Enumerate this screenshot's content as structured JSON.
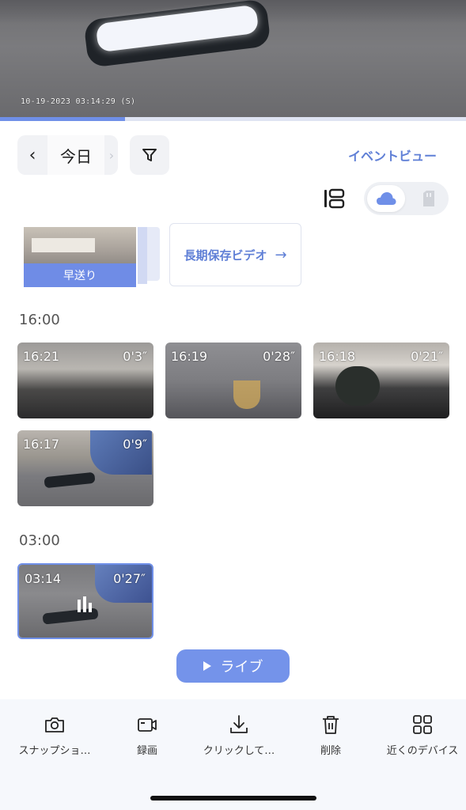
{
  "player": {
    "osd_timestamp": "10-19-2023 03:14:29  (S)",
    "progress": 0.27
  },
  "date_nav": {
    "prev_icon": "chevron-left-icon",
    "label": "今日",
    "next_icon": "chevron-right-icon"
  },
  "filter_icon": "filter-icon",
  "event_view_label": "イベントビュー",
  "storage": {
    "selected": "cloud",
    "options": [
      "cloud-icon",
      "sd-card-icon"
    ]
  },
  "fast_forward_label": "早送り",
  "long_term_video_label": "長期保存ビデオ",
  "long_term_arrow": "→",
  "sections": [
    {
      "title": "16:00",
      "clips": [
        {
          "time": "16:21",
          "duration": "0'3″"
        },
        {
          "time": "16:19",
          "duration": "0'28″"
        },
        {
          "time": "16:18",
          "duration": "0'21″"
        },
        {
          "time": "16:17",
          "duration": "0'9″"
        }
      ]
    },
    {
      "title": "03:00",
      "clips": [
        {
          "time": "03:14",
          "duration": "0'27″",
          "selected": true
        }
      ]
    }
  ],
  "live_label": "ライブ",
  "toolbar": [
    {
      "label": "スナップショ…",
      "icon": "camera-icon"
    },
    {
      "label": "録画",
      "icon": "video-record-icon"
    },
    {
      "label": "クリックして…",
      "icon": "download-icon"
    },
    {
      "label": "削除",
      "icon": "trash-icon"
    },
    {
      "label": "近くのデバイス",
      "icon": "grid-icon"
    }
  ]
}
